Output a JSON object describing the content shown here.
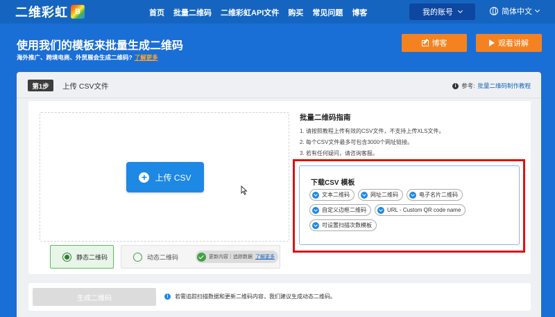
{
  "nav": {
    "logo_text": "二维彩虹",
    "logo_mark": "B",
    "links": [
      "首页",
      "批量二维码",
      "二维彩虹API文件",
      "购买",
      "常见问题",
      "博客"
    ],
    "account_label": "我的账号",
    "language": "简体中文"
  },
  "hero": {
    "title": "使用我们的模板来批量生成二维码",
    "subtitle": "海外推广、跨境电商、外贸展会生成二维码?",
    "learn_more": "了解更多",
    "blog_button": "博客",
    "watch_button": "观看讲解"
  },
  "step": {
    "badge": "第1步",
    "label": "上传 CSV文件",
    "ref_prefix": "参考:",
    "ref_link": "批量二维码制作教程"
  },
  "upload": {
    "button_label": "上传 CSV"
  },
  "qr_type": {
    "static_label": "静态二维码",
    "dynamic_label": "动态二维码",
    "dynamic_pill_text": "更新内容｜追踪数据",
    "dynamic_learn_more": "了解更多"
  },
  "guide": {
    "title": "批量二维码指南",
    "items": [
      "1. 请按照教程上传有效的CSV文件，不支持上传XLS文件。",
      "2. 每个CSV文件最多可包含3000个网址链接。",
      "3. 若有任何疑问，请咨询客服。"
    ]
  },
  "templates": {
    "title": "下载CSV 模板",
    "chips": [
      "文本二维码",
      "网址二维码",
      "电子名片二维码",
      "自定义边框二维码",
      "URL - Custom QR code name",
      "可设置扫描次数模板"
    ]
  },
  "generate": {
    "button_label": "生成二维码",
    "note": "若需追踪扫描数据和更新二维码内容，我们建议生成动态二维码。"
  },
  "colors": {
    "brand_blue": "#1a6fd6",
    "accent_orange": "#f58220",
    "highlight_red": "#e01010",
    "static_green": "#2e7d32"
  }
}
